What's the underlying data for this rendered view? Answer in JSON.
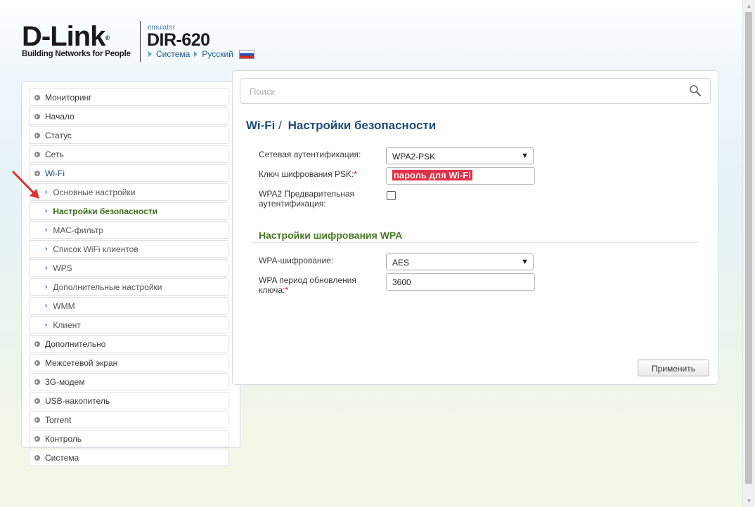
{
  "header": {
    "logo_text": "D-Link",
    "logo_reg": "®",
    "logo_tagline": "Building Networks for People",
    "emulator_label": "emulator",
    "model": "DIR-620",
    "nav_system": "Система",
    "nav_language": "Русский",
    "flag_icon": "russia-flag-icon"
  },
  "sidebar": {
    "items": [
      {
        "label": "Мониторинг",
        "level": 0
      },
      {
        "label": "Начало",
        "level": 0
      },
      {
        "label": "Статус",
        "level": 0
      },
      {
        "label": "Сеть",
        "level": 0
      },
      {
        "label": "Wi-Fi",
        "level": 0,
        "expanded": true
      },
      {
        "label": "Основные настройки",
        "level": 1
      },
      {
        "label": "Настройки безопасности",
        "level": 1,
        "active": true
      },
      {
        "label": "MAC-фильтр",
        "level": 1
      },
      {
        "label": "Список WiFi клиентов",
        "level": 1
      },
      {
        "label": "WPS",
        "level": 1
      },
      {
        "label": "Дополнительные настройки",
        "level": 1
      },
      {
        "label": "WMM",
        "level": 1
      },
      {
        "label": "Клиент",
        "level": 1
      },
      {
        "label": "Дополнительно",
        "level": 0
      },
      {
        "label": "Межсетевой экран",
        "level": 0
      },
      {
        "label": "3G-модем",
        "level": 0
      },
      {
        "label": "USB-накопитель",
        "level": 0
      },
      {
        "label": "Torrent",
        "level": 0
      },
      {
        "label": "Контроль",
        "level": 0
      },
      {
        "label": "Система",
        "level": 0
      }
    ]
  },
  "search": {
    "placeholder": "Поиск",
    "icon": "magnifier-icon"
  },
  "page": {
    "crumb": "Wi-Fi",
    "crumb_sep": "/",
    "title": "Настройки безопасности"
  },
  "form": {
    "auth_label": "Сетевая аутентификация:",
    "auth_value": "WPA2-PSK",
    "psk_label": "Ключ шифрования PSK:",
    "psk_required": "*",
    "psk_value": "пароль для Wi-Fi",
    "preauth_label_1": "WPA2 Предварительная",
    "preauth_label_2": "аутентификация:",
    "preauth_checked": false,
    "wpa_section_title": "Настройки шифрования WPA",
    "enc_label": "WPA-шифрование:",
    "enc_value": "AES",
    "rekey_label_1": "WPA период обновления",
    "rekey_label_2": "ключа:",
    "rekey_required": "*",
    "rekey_value": "3600",
    "apply_label": "Применить"
  },
  "colors": {
    "accent_blue": "#1f4d79",
    "accent_green": "#4a7a24",
    "required_red": "#d0021b",
    "annotation_red": "#e0334a"
  }
}
